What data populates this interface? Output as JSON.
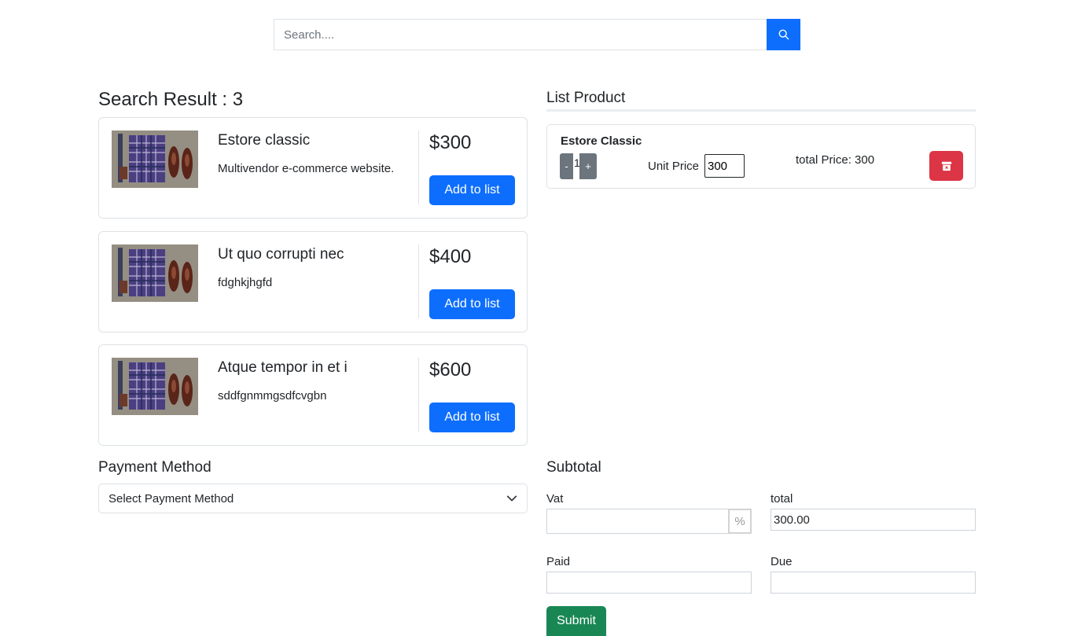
{
  "search": {
    "placeholder": "Search...."
  },
  "results": {
    "title": "Search Result : 3",
    "items": [
      {
        "name": "Estore classic",
        "description": "Multivendor e-commerce website.",
        "price": "$300",
        "button": "Add to list"
      },
      {
        "name": "Ut quo corrupti nec",
        "description": "fdghkjhgfd",
        "price": "$400",
        "button": "Add to list"
      },
      {
        "name": "Atque tempor in et i",
        "description": "sddfgnmmgsdfcvgbn",
        "price": "$600",
        "button": "Add to list"
      }
    ]
  },
  "list_product": {
    "title": "List Product",
    "items": [
      {
        "name": "Estore Classic",
        "qty_minus": "-",
        "qty": "1",
        "qty_plus": "+",
        "unit_price_label": "Unit Price",
        "unit_price": "300",
        "total_price": "total Price: 300"
      }
    ]
  },
  "payment": {
    "title": "Payment Method",
    "selected": "Select Payment Method"
  },
  "subtotal": {
    "title": "Subtotal",
    "vat_label": "Vat",
    "vat_value": "",
    "vat_suffix": "%",
    "total_label": "total",
    "total_value": "300.00",
    "paid_label": "Paid",
    "paid_value": "",
    "due_label": "Due",
    "due_value": "",
    "submit": "Submit"
  },
  "colors": {
    "primary": "#0d6efd",
    "danger": "#dc3545",
    "success": "#198754",
    "secondary": "#6c757d"
  },
  "icons": {
    "search": "search-icon",
    "delete": "trash-icon",
    "dropdown": "chevron-down-icon"
  }
}
